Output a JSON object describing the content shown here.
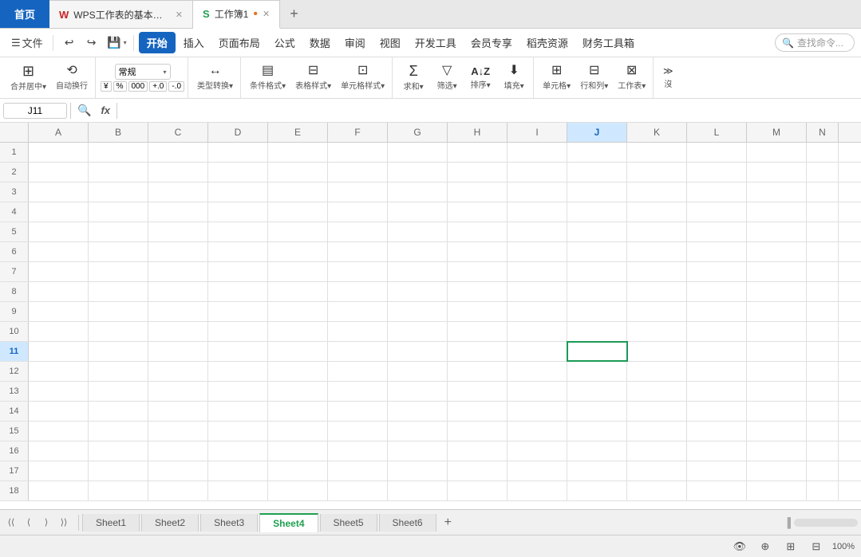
{
  "tabs": {
    "home": {
      "label": "首页"
    },
    "wps": {
      "label": "WPS工作表的基本操作",
      "icon": "W"
    },
    "workbook": {
      "label": "工作簿1",
      "icon": "S"
    },
    "add": {
      "label": "+"
    }
  },
  "menubar": {
    "sidebar": "☰ 文件",
    "undo": "↩",
    "redo": "↪",
    "save": "💾",
    "savearrow": "▾",
    "tabs": [
      "开始",
      "插入",
      "页面布局",
      "公式",
      "数据",
      "审阅",
      "视图",
      "开发工具",
      "会员专享",
      "稻壳资源",
      "财务工具箱"
    ],
    "search_placeholder": "🔍 查找命令..."
  },
  "toolbar": {
    "merge": {
      "icon": "⊞",
      "label": "合并居中▾"
    },
    "auto_convert": {
      "icon": "⟳",
      "label": "自动换行"
    },
    "format_normal": "常规",
    "currency": "¥",
    "percent": "%",
    "thousands": "000",
    "dec_inc": "+.0",
    "dec_dec": "-.0",
    "type_convert": {
      "icon": "↔",
      "label": "类型转换▾"
    },
    "conditional": {
      "icon": "⬜",
      "label": "条件格式▾"
    },
    "table_style": {
      "icon": "⊟",
      "label": "表格样式▾"
    },
    "cell_style": {
      "icon": "⊡",
      "label": "单元格样式▾"
    },
    "sum": {
      "icon": "Σ",
      "label": "求和▾"
    },
    "filter": {
      "icon": "▽",
      "label": "筛选▾"
    },
    "sort": {
      "icon": "AZ↓",
      "label": "排序▾"
    },
    "fill": {
      "icon": "⬇",
      "label": "填充▾"
    },
    "cell": {
      "icon": "⊞",
      "label": "单元格▾"
    },
    "row_col": {
      "icon": "⊟",
      "label": "行和列▾"
    },
    "worksheet": {
      "icon": "⊠",
      "label": "工作表▾"
    }
  },
  "formula_bar": {
    "cell_ref": "J11",
    "formula_value": ""
  },
  "columns": [
    "A",
    "B",
    "C",
    "D",
    "E",
    "F",
    "G",
    "H",
    "I",
    "J",
    "K",
    "L",
    "M",
    "N"
  ],
  "rows": [
    1,
    2,
    3,
    4,
    5,
    6,
    7,
    8,
    9,
    10,
    11,
    12,
    13,
    14,
    15,
    16,
    17,
    18
  ],
  "active_cell": {
    "row": 11,
    "col": "J"
  },
  "sheets": {
    "tabs": [
      "Sheet1",
      "Sheet2",
      "Sheet3",
      "Sheet4",
      "Sheet5",
      "Sheet6"
    ],
    "active": "Sheet4"
  },
  "statusbar": {
    "zoom": "100%",
    "eye_icon": "👁",
    "globe_icon": "⊕",
    "grid_icon": "⊞",
    "split_icon": "⊟"
  }
}
